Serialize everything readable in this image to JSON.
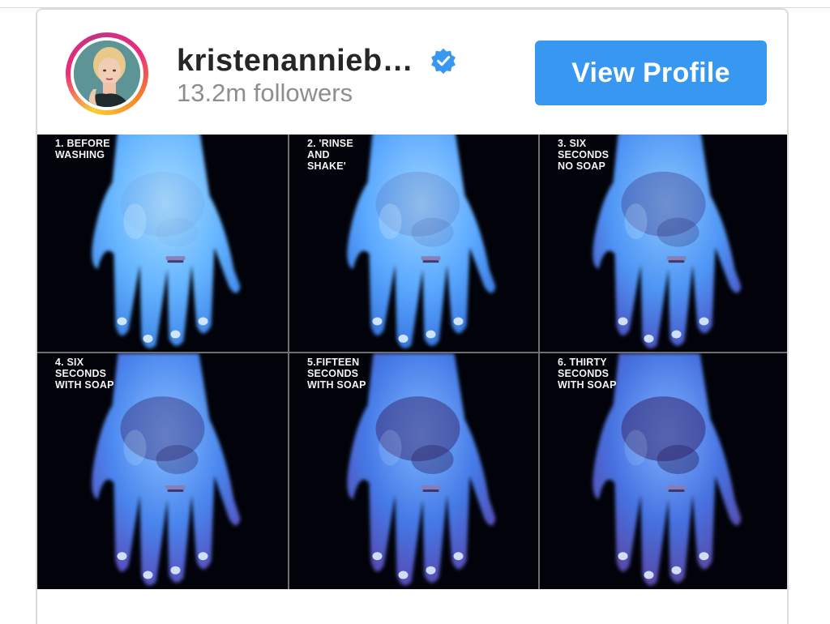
{
  "profile": {
    "username": "kristenannieb…",
    "followers": "13.2m followers",
    "view_profile_label": "View Profile"
  },
  "icons": {
    "verified": "verified-badge-icon"
  },
  "colors": {
    "button": "#3897f0",
    "verified": "#3897f0",
    "username": "#262626",
    "followers": "#8e8e8e",
    "hand_glow": "#5aa8ff",
    "panel_background": "#02030a"
  },
  "post_image": {
    "panels": [
      {
        "caption": "1. BEFORE\nWASHING"
      },
      {
        "caption": "2. 'RINSE\nAND\nSHAKE'"
      },
      {
        "caption": "3. SIX\nSECONDS\nNO SOAP"
      },
      {
        "caption": "4. SIX\nSECONDS\nWITH SOAP"
      },
      {
        "caption": "5.FIFTEEN\nSECONDS\nWITH SOAP"
      },
      {
        "caption": "6. THIRTY\nSECONDS\nWITH SOAP"
      }
    ]
  }
}
